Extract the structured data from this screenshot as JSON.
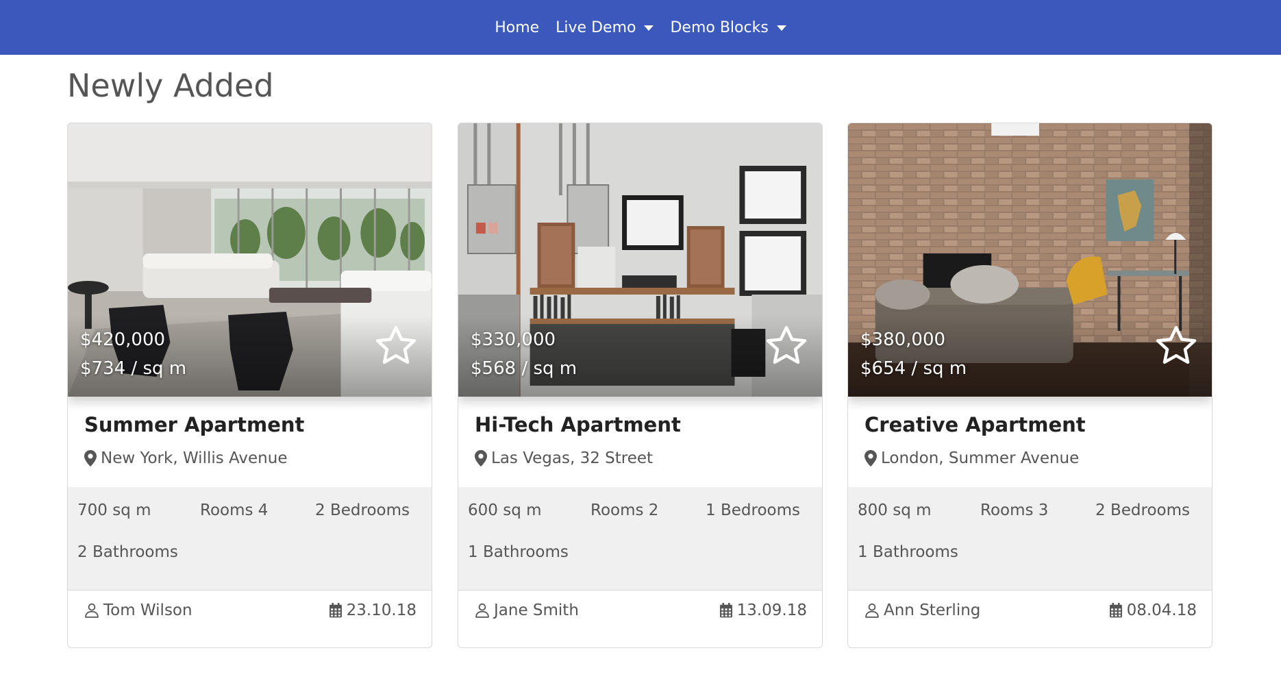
{
  "nav": {
    "items": [
      {
        "label": "Home"
      },
      {
        "label": "Live Demo"
      },
      {
        "label": "Demo Blocks"
      }
    ]
  },
  "page_title": "Newly Added",
  "cards": [
    {
      "price": "$420,000",
      "price_per_sqm": "$734 / sq m",
      "title": "Summer Apartment",
      "location": "New York, Willis Avenue",
      "area": "700 sq m",
      "rooms": "Rooms 4",
      "bedrooms": "2 Bedrooms",
      "bathrooms": "2 Bathrooms",
      "agent": "Tom Wilson",
      "date": "23.10.18"
    },
    {
      "price": "$330,000",
      "price_per_sqm": "$568 / sq m",
      "title": "Hi-Tech Apartment",
      "location": "Las Vegas, 32 Street",
      "area": "600 sq m",
      "rooms": "Rooms 2",
      "bedrooms": "1 Bedrooms",
      "bathrooms": "1 Bathrooms",
      "agent": "Jane Smith",
      "date": "13.09.18"
    },
    {
      "price": "$380,000",
      "price_per_sqm": "$654 / sq m",
      "title": "Creative Apartment",
      "location": "London, Summer Avenue",
      "area": "800 sq m",
      "rooms": "Rooms 3",
      "bedrooms": "2 Bedrooms",
      "bathrooms": "1 Bathrooms",
      "agent": "Ann Sterling",
      "date": "08.04.18"
    }
  ],
  "colors": {
    "navbar": "#3b59bd",
    "features_bg": "#f0f0f0",
    "text_muted": "#555555"
  },
  "icons": {
    "favorite": "star-outline-icon",
    "location": "map-pin-icon",
    "agent": "user-icon",
    "date": "calendar-icon",
    "dropdown": "caret-down-icon"
  }
}
